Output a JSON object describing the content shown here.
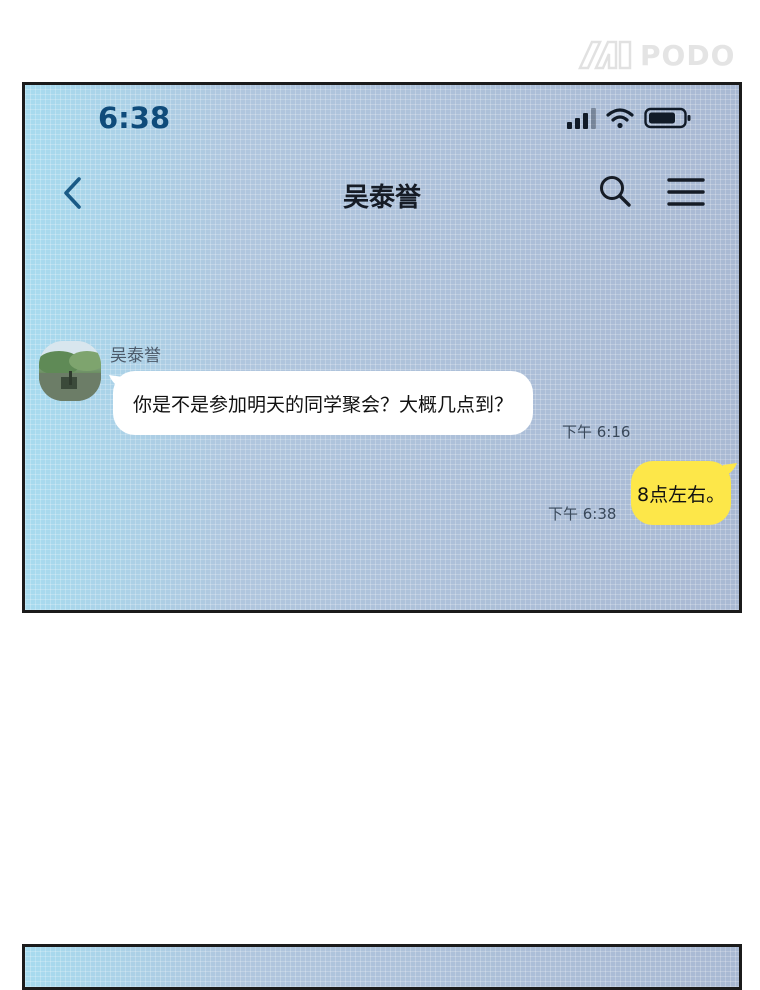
{
  "watermark": {
    "text": "PODO"
  },
  "status_bar": {
    "time": "6:38",
    "icons": [
      "cellular-signal-icon",
      "wifi-icon",
      "battery-icon"
    ]
  },
  "nav": {
    "title": "吴泰誉",
    "icons": [
      "chevron-left-icon",
      "search-icon",
      "menu-icon"
    ]
  },
  "messages": [
    {
      "direction": "incoming",
      "sender": "吴泰誉",
      "text": "你是不是参加明天的同学聚会？大概几点到？",
      "time": "下午 6:16"
    },
    {
      "direction": "outgoing",
      "text": "8点左右。",
      "time": "下午 6:38"
    }
  ],
  "colors": {
    "bubble_out": "#fde749",
    "bubble_in": "#ffffff",
    "background": "#a8bcd2",
    "time_text": "#0f4b7a"
  }
}
